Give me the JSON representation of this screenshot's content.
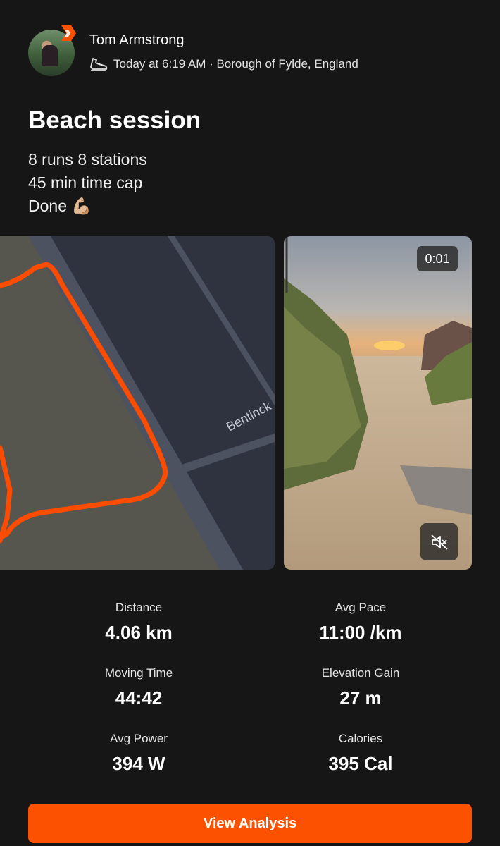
{
  "activity": {
    "athlete_name": "Tom Armstrong",
    "meta": "Today at 6:19 AM · Borough of Fylde, England",
    "title": "Beach session",
    "description_lines": [
      "8 runs 8 stations",
      "45 min time cap",
      "Done 💪🏼"
    ]
  },
  "map": {
    "road_label": "Bentinck",
    "route_color": "#fc4c02"
  },
  "media": {
    "duration": "0:01",
    "mute_icon": "speaker-muted-icon"
  },
  "stats": {
    "distance": {
      "label": "Distance",
      "value": "4.06 km"
    },
    "avg_pace": {
      "label": "Avg Pace",
      "value": "11:00 /km"
    },
    "moving_time": {
      "label": "Moving Time",
      "value": "44:42"
    },
    "elevation_gain": {
      "label": "Elevation Gain",
      "value": "27 m"
    },
    "avg_power": {
      "label": "Avg Power",
      "value": "394 W"
    },
    "calories": {
      "label": "Calories",
      "value": "395 Cal"
    }
  },
  "actions": {
    "view_analysis": "View Analysis"
  },
  "colors": {
    "accent": "#fc5200",
    "background": "#161616"
  }
}
